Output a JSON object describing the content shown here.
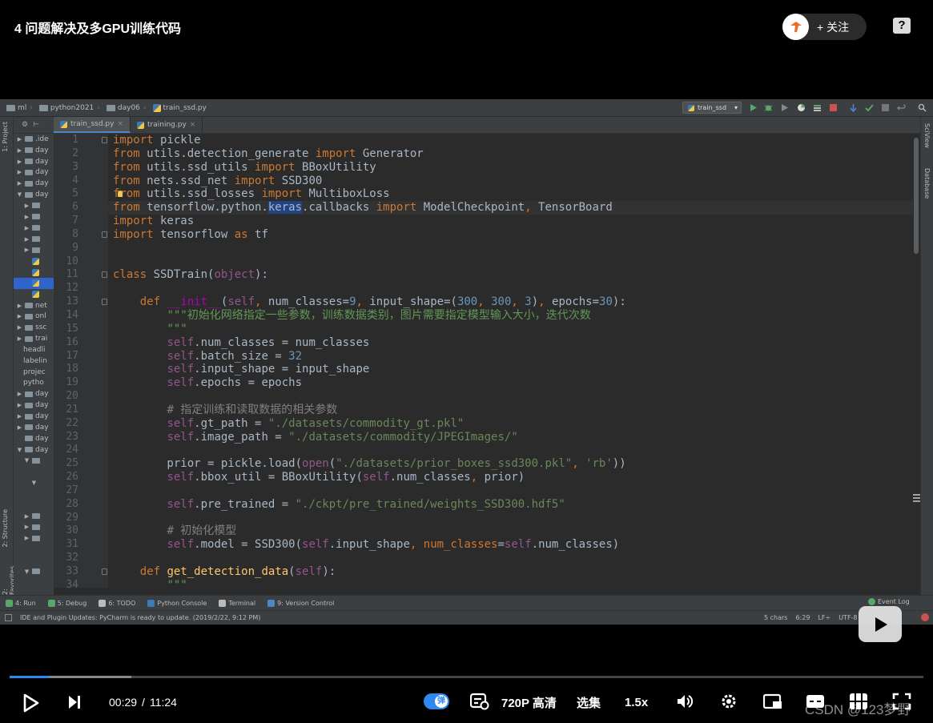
{
  "video": {
    "title": "4 问题解决及多GPU训练代码",
    "follow_label": "+ 关注",
    "help_label": "?"
  },
  "ide": {
    "breadcrumbs": [
      "ml",
      "python2021",
      "day06",
      "train_ssd.py"
    ],
    "run_config": "train_ssd",
    "left_tabs": [
      "1: Project",
      "2: Structure",
      "2: Favorites"
    ],
    "right_tabs": [
      "SciView",
      "Database"
    ],
    "tabs": [
      {
        "label": "train_ssd.py",
        "active": true
      },
      {
        "label": "training.py",
        "active": false
      }
    ],
    "project_tree": [
      {
        "label": ".ide",
        "arrow": "▶",
        "icon": "folder",
        "indent": 0
      },
      {
        "label": "day",
        "arrow": "▶",
        "icon": "folder",
        "indent": 0
      },
      {
        "label": "day",
        "arrow": "▶",
        "icon": "folder",
        "indent": 0
      },
      {
        "label": "day",
        "arrow": "▶",
        "icon": "folder",
        "indent": 0
      },
      {
        "label": "day",
        "arrow": "▶",
        "icon": "folder",
        "indent": 0
      },
      {
        "label": "day",
        "arrow": "▼",
        "icon": "folder",
        "indent": 0
      },
      {
        "label": "",
        "arrow": "▶",
        "icon": "folder",
        "indent": 1
      },
      {
        "label": "",
        "arrow": "▶",
        "icon": "folder",
        "indent": 1
      },
      {
        "label": "",
        "arrow": "▶",
        "icon": "folder",
        "indent": 1
      },
      {
        "label": "",
        "arrow": "▶",
        "icon": "folder",
        "indent": 1
      },
      {
        "label": "",
        "arrow": "▶",
        "icon": "folder",
        "indent": 1
      },
      {
        "label": "",
        "arrow": "",
        "icon": "py",
        "indent": 1
      },
      {
        "label": "",
        "arrow": "",
        "icon": "py",
        "indent": 1
      },
      {
        "label": "",
        "arrow": "",
        "icon": "py",
        "indent": 1,
        "selected": true
      },
      {
        "label": "",
        "arrow": "",
        "icon": "py",
        "indent": 1
      },
      {
        "label": "net",
        "arrow": "▶",
        "icon": "folder",
        "indent": 0
      },
      {
        "label": "onl",
        "arrow": "▶",
        "icon": "folder",
        "indent": 0
      },
      {
        "label": "ssc",
        "arrow": "▶",
        "icon": "folder",
        "indent": 0
      },
      {
        "label": "trai",
        "arrow": "▶",
        "icon": "folder",
        "indent": 0
      },
      {
        "label": "headli",
        "arrow": "",
        "icon": "none",
        "indent": 0
      },
      {
        "label": "labelin",
        "arrow": "",
        "icon": "none",
        "indent": 0
      },
      {
        "label": "projec",
        "arrow": "",
        "icon": "none",
        "indent": 0
      },
      {
        "label": "pytho",
        "arrow": "",
        "icon": "none",
        "indent": 0
      },
      {
        "label": "day",
        "arrow": "▶",
        "icon": "folder",
        "indent": 0
      },
      {
        "label": "day",
        "arrow": "▶",
        "icon": "folder",
        "indent": 0
      },
      {
        "label": "day",
        "arrow": "▶",
        "icon": "folder",
        "indent": 0
      },
      {
        "label": "day",
        "arrow": "▶",
        "icon": "folder",
        "indent": 0
      },
      {
        "label": "day",
        "arrow": "",
        "icon": "folder",
        "indent": 0
      },
      {
        "label": "day",
        "arrow": "▼",
        "icon": "folder",
        "indent": 0
      },
      {
        "label": "",
        "arrow": "▼",
        "icon": "folder",
        "indent": 1
      },
      {
        "label": "",
        "arrow": "",
        "icon": "none",
        "indent": 2
      },
      {
        "label": "",
        "arrow": "▼",
        "icon": "none",
        "indent": 2
      },
      {
        "label": "",
        "arrow": "",
        "icon": "none",
        "indent": 2
      },
      {
        "label": "",
        "arrow": "",
        "icon": "none",
        "indent": 2
      },
      {
        "label": "",
        "arrow": "▶",
        "icon": "folder",
        "indent": 1
      },
      {
        "label": "",
        "arrow": "▶",
        "icon": "folder",
        "indent": 1
      },
      {
        "label": "",
        "arrow": "▶",
        "icon": "folder",
        "indent": 1
      },
      {
        "label": "",
        "arrow": "",
        "icon": "none",
        "indent": 0
      },
      {
        "label": "",
        "arrow": "",
        "icon": "none",
        "indent": 0
      },
      {
        "label": "",
        "arrow": "▼",
        "icon": "folder",
        "indent": 1
      }
    ],
    "code_lines": [
      [
        [
          "kw",
          "import"
        ],
        [
          "p",
          " pickle"
        ]
      ],
      [
        [
          "kw",
          "from"
        ],
        [
          "p",
          " utils.detection_generate "
        ],
        [
          "kw",
          "import"
        ],
        [
          "p",
          " Generator"
        ]
      ],
      [
        [
          "kw",
          "from"
        ],
        [
          "p",
          " utils.ssd_utils "
        ],
        [
          "kw",
          "import"
        ],
        [
          "p",
          " BBoxUtility"
        ]
      ],
      [
        [
          "kw",
          "from"
        ],
        [
          "p",
          " nets.ssd_net "
        ],
        [
          "kw",
          "import"
        ],
        [
          "p",
          " SSD300"
        ]
      ],
      [
        [
          "kw",
          "from"
        ],
        [
          "p",
          " utils.ssd_losses "
        ],
        [
          "kw",
          "import"
        ],
        [
          "p",
          " MultiboxLoss"
        ]
      ],
      [
        [
          "kw",
          "from"
        ],
        [
          "p",
          " tensorflow.python."
        ],
        [
          "sel",
          "keras"
        ],
        [
          "p",
          ".callbacks "
        ],
        [
          "kw",
          "import"
        ],
        [
          "p",
          " ModelCheckpoint"
        ],
        [
          "kw",
          ","
        ],
        [
          "p",
          " TensorBoard"
        ]
      ],
      [
        [
          "kw",
          "import"
        ],
        [
          "p",
          " keras"
        ]
      ],
      [
        [
          "kw",
          "import"
        ],
        [
          "p",
          " tensorflow "
        ],
        [
          "kw",
          "as"
        ],
        [
          "p",
          " tf"
        ]
      ],
      [],
      [],
      [
        [
          "kw",
          "class"
        ],
        [
          "p",
          " SSDTrain("
        ],
        [
          "selfk",
          "object"
        ],
        [
          "p",
          "):"
        ]
      ],
      [],
      [
        [
          "p",
          "    "
        ],
        [
          "kw",
          "def"
        ],
        [
          "p",
          " "
        ],
        [
          "magic",
          "__init__"
        ],
        [
          "p",
          "("
        ],
        [
          "selfk",
          "self"
        ],
        [
          "kw",
          ","
        ],
        [
          "p",
          " num_classes="
        ],
        [
          "num",
          "9"
        ],
        [
          "kw",
          ","
        ],
        [
          "p",
          " input_shape=("
        ],
        [
          "num",
          "300"
        ],
        [
          "kw",
          ","
        ],
        [
          "p",
          " "
        ],
        [
          "num",
          "300"
        ],
        [
          "kw",
          ","
        ],
        [
          "p",
          " "
        ],
        [
          "num",
          "3"
        ],
        [
          "p",
          ")"
        ],
        [
          "kw",
          ","
        ],
        [
          "p",
          " epochs="
        ],
        [
          "num",
          "30"
        ],
        [
          "p",
          "):"
        ]
      ],
      [
        [
          "p",
          "        "
        ],
        [
          "doc",
          "\"\"\"初始化网络指定一些参数，训练数据类别，图片需要指定模型输入大小，迭代次数"
        ]
      ],
      [
        [
          "p",
          "        "
        ],
        [
          "doc",
          "\"\"\""
        ]
      ],
      [
        [
          "p",
          "        "
        ],
        [
          "selfk",
          "self"
        ],
        [
          "p",
          ".num_classes = num_classes"
        ]
      ],
      [
        [
          "p",
          "        "
        ],
        [
          "selfk",
          "self"
        ],
        [
          "p",
          ".batch_size = "
        ],
        [
          "num",
          "32"
        ]
      ],
      [
        [
          "p",
          "        "
        ],
        [
          "selfk",
          "self"
        ],
        [
          "p",
          ".input_shape = input_shape"
        ]
      ],
      [
        [
          "p",
          "        "
        ],
        [
          "selfk",
          "self"
        ],
        [
          "p",
          ".epochs = epochs"
        ]
      ],
      [],
      [
        [
          "p",
          "        "
        ],
        [
          "cmt",
          "# 指定训练和读取数据的相关参数"
        ]
      ],
      [
        [
          "p",
          "        "
        ],
        [
          "selfk",
          "self"
        ],
        [
          "p",
          ".gt_path = "
        ],
        [
          "str",
          "\"./datasets/commodity_gt.pkl\""
        ]
      ],
      [
        [
          "p",
          "        "
        ],
        [
          "selfk",
          "self"
        ],
        [
          "p",
          ".image_path = "
        ],
        [
          "str",
          "\"./datasets/commodity/JPEGImages/\""
        ]
      ],
      [],
      [
        [
          "p",
          "        prior = pickle.load("
        ],
        [
          "selfk",
          "open"
        ],
        [
          "p",
          "("
        ],
        [
          "str",
          "\"./datasets/prior_boxes_ssd300.pkl\""
        ],
        [
          "kw",
          ","
        ],
        [
          "p",
          " "
        ],
        [
          "str",
          "'rb'"
        ],
        [
          "p",
          "))"
        ]
      ],
      [
        [
          "p",
          "        "
        ],
        [
          "selfk",
          "self"
        ],
        [
          "p",
          ".bbox_util = BBoxUtility("
        ],
        [
          "selfk",
          "self"
        ],
        [
          "p",
          ".num_classes"
        ],
        [
          "kw",
          ","
        ],
        [
          "p",
          " prior)"
        ]
      ],
      [],
      [
        [
          "p",
          "        "
        ],
        [
          "selfk",
          "self"
        ],
        [
          "p",
          ".pre_trained = "
        ],
        [
          "str",
          "\"./ckpt/pre_trained/weights_SSD300.hdf5\""
        ]
      ],
      [],
      [
        [
          "p",
          "        "
        ],
        [
          "cmt",
          "# 初始化模型"
        ]
      ],
      [
        [
          "p",
          "        "
        ],
        [
          "selfk",
          "self"
        ],
        [
          "p",
          ".model = SSD300("
        ],
        [
          "selfk",
          "self"
        ],
        [
          "p",
          ".input_shape"
        ],
        [
          "kw",
          ","
        ],
        [
          "p",
          " "
        ],
        [
          "kw",
          "num_classes"
        ],
        [
          "p",
          "="
        ],
        [
          "selfk",
          "self"
        ],
        [
          "p",
          ".num_classes)"
        ]
      ],
      [],
      [
        [
          "p",
          "    "
        ],
        [
          "kw",
          "def"
        ],
        [
          "p",
          " "
        ],
        [
          "fn",
          "get_detection_data"
        ],
        [
          "p",
          "("
        ],
        [
          "selfk",
          "self"
        ],
        [
          "p",
          "):"
        ]
      ],
      [
        [
          "p",
          "        "
        ],
        [
          "doc",
          "\"\"\""
        ]
      ]
    ],
    "line_count": 34,
    "current_line": 6,
    "fold_lines": [
      1,
      8,
      11,
      13,
      33
    ],
    "bottom_tools": [
      {
        "label": "4: Run",
        "icon": "run-icon",
        "color": "#59a869"
      },
      {
        "label": "5: Debug",
        "icon": "debug-icon",
        "color": "#59a869"
      },
      {
        "label": "6: TODO",
        "icon": "todo-icon",
        "color": "#bbbbbb"
      },
      {
        "label": "Python Console",
        "icon": "python-console-icon",
        "color": "#3e7ab8"
      },
      {
        "label": "Terminal",
        "icon": "terminal-icon",
        "color": "#bbbbbb"
      },
      {
        "label": "9: Version Control",
        "icon": "version-control-icon",
        "color": "#4a88c7"
      }
    ],
    "event_log": "Event Log",
    "status_message": "IDE and Plugin Updates: PyCharm is ready to update. (2019/2/22, 9:12 PM)",
    "status_right": [
      "5 chars",
      "6:29",
      "LF÷",
      "UTF-8"
    ]
  },
  "player": {
    "current_time": "00:29",
    "separator": "/",
    "duration": "11:24",
    "played_fraction": 0.043,
    "buffered_fraction": 0.133,
    "danmaku_toggle": "弹",
    "quality": "720P 高清",
    "episodes": "选集",
    "speed": "1.5x",
    "watermark": "CSDN @123梦野"
  },
  "colors": {
    "accent": "#2e88f0",
    "editor_bg": "#2b2b2b",
    "keyword": "#cc7832",
    "string": "#6a8759",
    "number": "#6897bb",
    "self": "#94558d"
  }
}
